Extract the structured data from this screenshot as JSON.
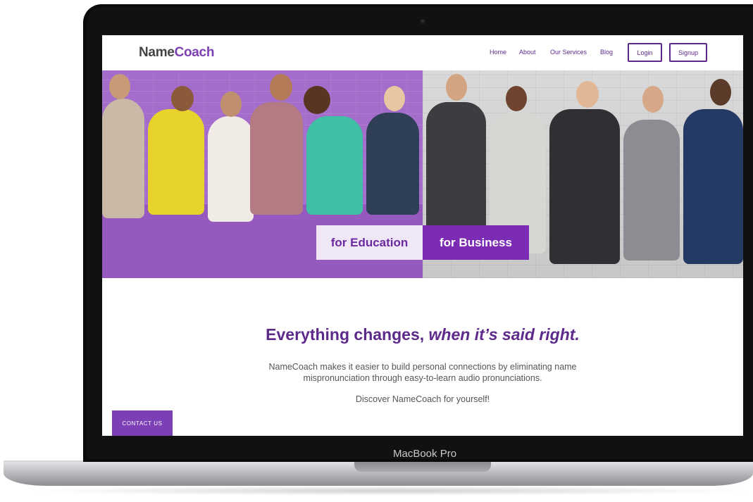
{
  "device": {
    "label": "MacBook Pro"
  },
  "nav": {
    "logo_part1": "Name",
    "logo_part2": "Coach",
    "links": [
      "Home",
      "About",
      "Our Services",
      "Blog"
    ],
    "login_label": "Login",
    "signup_label": "Signup"
  },
  "hero": {
    "education_label": "for Education",
    "business_label": "for Business"
  },
  "main": {
    "headline_plain": "Everything changes,",
    "headline_emph": "when it’s said right.",
    "description_line1": "NameCoach makes it easier to build personal connections by eliminating name",
    "description_line2": "mispronunciation through easy-to-learn audio pronunciations.",
    "discover": "Discover NameCoach for yourself!",
    "contact_label": "CONTACT US"
  },
  "colors": {
    "brand_purple": "#5d2a8a",
    "accent_purple": "#7c2bb4"
  }
}
